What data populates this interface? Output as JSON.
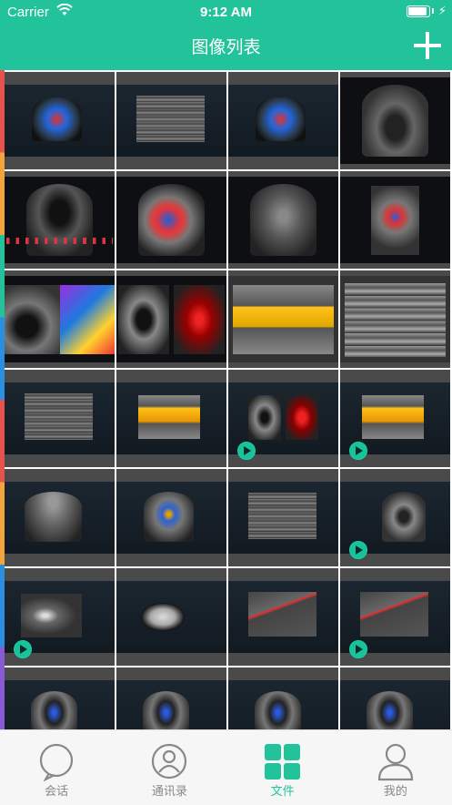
{
  "status": {
    "carrier": "Carrier",
    "time": "9:12 AM",
    "battery_level": 1.0
  },
  "header": {
    "title": "图像列表"
  },
  "colors": {
    "accent": "#22c39b",
    "stripe": [
      "#e8524c",
      "#f2a53b",
      "#22c39b",
      "#2b8ee0",
      "#e8524c",
      "#f2a53b",
      "#2b8ee0",
      "#8a5ad6"
    ]
  },
  "grid": {
    "images": [
      {
        "kind": "doppler-panel",
        "video": false
      },
      {
        "kind": "linear-panel",
        "video": false
      },
      {
        "kind": "doppler-panel",
        "video": false
      },
      {
        "kind": "cardiac-fan",
        "video": false
      },
      {
        "kind": "cardiac-ecg",
        "video": false
      },
      {
        "kind": "cardiac-color",
        "video": false
      },
      {
        "kind": "abdomen-fan",
        "video": false
      },
      {
        "kind": "thyroid-color",
        "video": false
      },
      {
        "kind": "vessel-color",
        "video": false
      },
      {
        "kind": "dual-cardiac",
        "video": false
      },
      {
        "kind": "carotid-yellow",
        "video": false
      },
      {
        "kind": "linear-gray",
        "video": false
      },
      {
        "kind": "linear-panel",
        "video": false
      },
      {
        "kind": "carotid-panel",
        "video": false
      },
      {
        "kind": "dual-cardiac-panel",
        "video": true
      },
      {
        "kind": "carotid-panel",
        "video": true
      },
      {
        "kind": "liver-panel",
        "video": false
      },
      {
        "kind": "kidney-panel",
        "video": false
      },
      {
        "kind": "linear-panel",
        "video": false
      },
      {
        "kind": "fetal-panel",
        "video": true
      },
      {
        "kind": "abdomen-panel",
        "video": true
      },
      {
        "kind": "blob-panel",
        "video": false
      },
      {
        "kind": "vessel-red-panel",
        "video": false
      },
      {
        "kind": "vessel-red-panel",
        "video": true
      },
      {
        "kind": "cardiac-small-panel",
        "video": false
      },
      {
        "kind": "cardiac-small-panel",
        "video": false
      },
      {
        "kind": "cardiac-small-panel",
        "video": false
      },
      {
        "kind": "cardiac-small-panel",
        "video": false
      }
    ]
  },
  "tabs": [
    {
      "label": "会话",
      "icon": "chat-bubble-icon",
      "active": false
    },
    {
      "label": "通讯录",
      "icon": "contacts-icon",
      "active": false
    },
    {
      "label": "文件",
      "icon": "files-grid-icon",
      "active": true
    },
    {
      "label": "我的",
      "icon": "profile-icon",
      "active": false
    }
  ]
}
